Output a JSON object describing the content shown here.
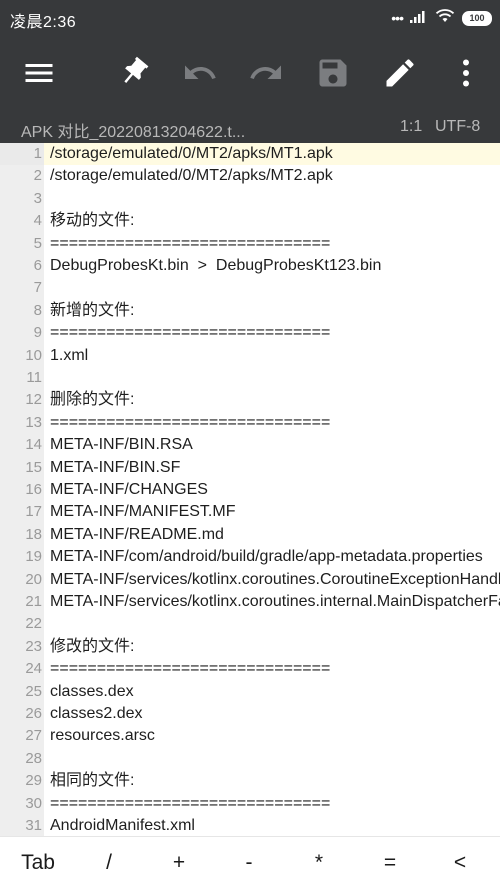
{
  "status": {
    "time": "凌晨2:36",
    "signal_dots": "•••",
    "battery": "100"
  },
  "toolbar": {
    "icons": [
      "menu-icon",
      "pin-icon",
      "undo-icon",
      "redo-icon",
      "save-icon",
      "edit-icon",
      "more-icon"
    ],
    "colors": {
      "background": "#37393b",
      "active_icon": "#ffffff",
      "disabled_icon": "#7b7d80"
    }
  },
  "info": {
    "filename": "APK 对比_20220813204622.t...",
    "cursor": "1:1",
    "encoding": "UTF-8"
  },
  "editor": {
    "current_line": 1,
    "lines": [
      {
        "n": "1",
        "text": "/storage/emulated/0/MT2/apks/MT1.apk"
      },
      {
        "n": "2",
        "text": "/storage/emulated/0/MT2/apks/MT2.apk"
      },
      {
        "n": "3",
        "text": ""
      },
      {
        "n": "4",
        "text": "移动的文件:"
      },
      {
        "n": "5",
        "text": "=============================="
      },
      {
        "n": "6",
        "text": "DebugProbesKt.bin  >  DebugProbesKt123.bin"
      },
      {
        "n": "7",
        "text": ""
      },
      {
        "n": "8",
        "text": "新增的文件:"
      },
      {
        "n": "9",
        "text": "=============================="
      },
      {
        "n": "10",
        "text": "1.xml"
      },
      {
        "n": "11",
        "text": ""
      },
      {
        "n": "12",
        "text": "删除的文件:"
      },
      {
        "n": "13",
        "text": "=============================="
      },
      {
        "n": "14",
        "text": "META-INF/BIN.RSA"
      },
      {
        "n": "15",
        "text": "META-INF/BIN.SF"
      },
      {
        "n": "16",
        "text": "META-INF/CHANGES"
      },
      {
        "n": "17",
        "text": "META-INF/MANIFEST.MF"
      },
      {
        "n": "18",
        "text": "META-INF/README.md"
      },
      {
        "n": "19",
        "text": "META-INF/com/android/build/gradle/app-metadata.properties"
      },
      {
        "n": "20",
        "text": "META-INF/services/kotlinx.coroutines.CoroutineExceptionHandler"
      },
      {
        "n": "21",
        "text": "META-INF/services/kotlinx.coroutines.internal.MainDispatcherFactory"
      },
      {
        "n": "22",
        "text": ""
      },
      {
        "n": "23",
        "text": "修改的文件:"
      },
      {
        "n": "24",
        "text": "=============================="
      },
      {
        "n": "25",
        "text": "classes.dex"
      },
      {
        "n": "26",
        "text": "classes2.dex"
      },
      {
        "n": "27",
        "text": "resources.arsc"
      },
      {
        "n": "28",
        "text": ""
      },
      {
        "n": "29",
        "text": "相同的文件:"
      },
      {
        "n": "30",
        "text": "=============================="
      },
      {
        "n": "31",
        "text": "AndroidManifest.xml"
      }
    ]
  },
  "keybar": {
    "keys": [
      "Tab",
      "/",
      "+",
      "-",
      "*",
      "=",
      "<"
    ]
  }
}
